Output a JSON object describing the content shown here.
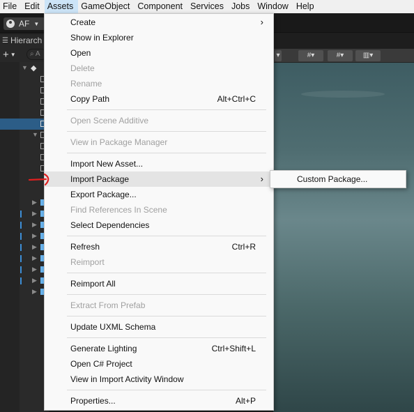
{
  "menubar": {
    "items": [
      "File",
      "Edit",
      "Assets",
      "GameObject",
      "Component",
      "Services",
      "Jobs",
      "Window",
      "Help"
    ]
  },
  "toolbar": {
    "account_label": "AF"
  },
  "hierarchy": {
    "tab_label": "Hierarch",
    "add_label": "+",
    "search_placeholder": "A"
  },
  "context_menu": {
    "items": [
      {
        "label": "Create",
        "submenu": true
      },
      {
        "label": "Show in Explorer"
      },
      {
        "label": "Open"
      },
      {
        "label": "Delete",
        "disabled": true
      },
      {
        "label": "Rename",
        "disabled": true
      },
      {
        "label": "Copy Path",
        "shortcut": "Alt+Ctrl+C"
      },
      {
        "label": "Open Scene Additive",
        "disabled": true
      },
      {
        "label": "View in Package Manager",
        "disabled": true
      },
      {
        "label": "Import New Asset..."
      },
      {
        "label": "Import Package",
        "submenu": true,
        "hover": true
      },
      {
        "label": "Export Package..."
      },
      {
        "label": "Find References In Scene",
        "disabled": true
      },
      {
        "label": "Select Dependencies"
      },
      {
        "label": "Refresh",
        "shortcut": "Ctrl+R"
      },
      {
        "label": "Reimport",
        "disabled": true
      },
      {
        "label": "Reimport All"
      },
      {
        "label": "Extract From Prefab",
        "disabled": true
      },
      {
        "label": "Update UXML Schema"
      },
      {
        "label": "Generate Lighting",
        "shortcut": "Ctrl+Shift+L"
      },
      {
        "label": "Open C# Project"
      },
      {
        "label": "View in Import Activity Window"
      },
      {
        "label": "Properties...",
        "shortcut": "Alt+P"
      }
    ]
  },
  "submenu": {
    "items": [
      {
        "label": "Custom Package..."
      }
    ]
  },
  "colors": {
    "accent_selection": "#2c5d87",
    "annotation": "#e02020"
  }
}
